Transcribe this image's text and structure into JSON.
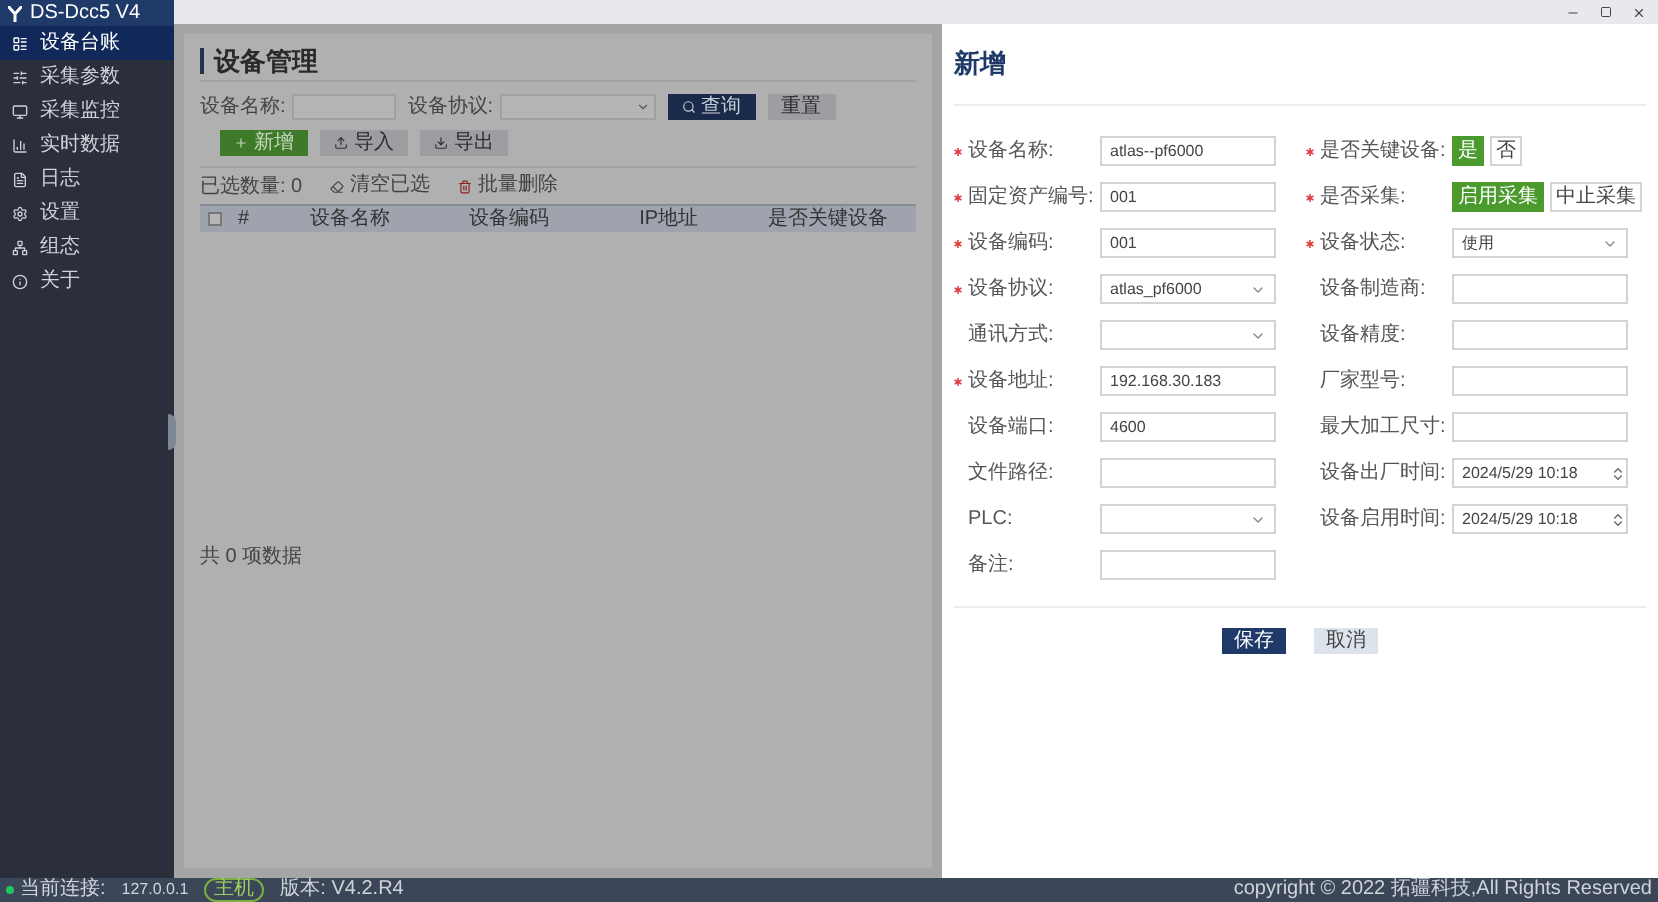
{
  "app": {
    "title": "DS-Dcc5 V4"
  },
  "sidebar": {
    "items": [
      {
        "label": "设备台账",
        "selected": true
      },
      {
        "label": "采集参数",
        "selected": false
      },
      {
        "label": "采集监控",
        "selected": false
      },
      {
        "label": "实时数据",
        "selected": false
      },
      {
        "label": "日志",
        "selected": false
      },
      {
        "label": "设置",
        "selected": false
      },
      {
        "label": "组态",
        "selected": false
      },
      {
        "label": "关于",
        "selected": false
      }
    ]
  },
  "page": {
    "title": "设备管理",
    "filters": [
      {
        "label": "设备名称:",
        "kind": "input"
      },
      {
        "label": "设备协议:",
        "kind": "select"
      }
    ],
    "buttons": [
      {
        "label": "查询",
        "kind": "primary"
      },
      {
        "label": "重置",
        "kind": "plain"
      },
      {
        "label": "新增",
        "kind": "success"
      },
      {
        "label": "导入",
        "kind": "plain"
      },
      {
        "label": "导出",
        "kind": "plain"
      }
    ],
    "selection": {
      "count": "已选数量: 0",
      "clear": "清空已选",
      "delete": "批量删除"
    },
    "table": {
      "checked": false,
      "columns": [
        "#",
        "设备名称",
        "设备编码",
        "IP地址",
        "是否关键设备"
      ],
      "footer": "共 0 项数据"
    }
  },
  "drawer": {
    "title": "新增",
    "left_fields": [
      {
        "label": "设备名称:",
        "required": true,
        "kind": "input",
        "value": "atlas--pf6000"
      },
      {
        "label": "固定资产编号:",
        "required": true,
        "kind": "input",
        "value": "001"
      },
      {
        "label": "设备编码:",
        "required": true,
        "kind": "input",
        "value": "001"
      },
      {
        "label": "设备协议:",
        "required": true,
        "kind": "select",
        "value": "atlas_pf6000"
      },
      {
        "label": "通讯方式:",
        "required": false,
        "kind": "select"
      },
      {
        "label": "设备地址:",
        "required": true,
        "kind": "input",
        "value": "192.168.30.183"
      },
      {
        "label": "设备端口:",
        "required": false,
        "kind": "input",
        "value": "4600"
      },
      {
        "label": "文件路径:",
        "required": false,
        "kind": "input"
      },
      {
        "label": "PLC:",
        "required": false,
        "kind": "select"
      },
      {
        "label": "备注:",
        "required": false,
        "kind": "input"
      }
    ],
    "right_fields": [
      {
        "label": "是否关键设备:",
        "required": true,
        "kind": "toggle",
        "options": [
          {
            "label": "是",
            "selected": true
          },
          {
            "label": "否",
            "selected": false
          }
        ]
      },
      {
        "label": "是否采集:",
        "required": true,
        "kind": "toggle",
        "options": [
          {
            "label": "启用采集",
            "selected": true
          },
          {
            "label": "中止采集",
            "selected": false
          }
        ]
      },
      {
        "label": "设备状态:",
        "required": true,
        "kind": "select",
        "value": "使用"
      },
      {
        "label": "设备制造商:",
        "required": false,
        "kind": "input"
      },
      {
        "label": "设备精度:",
        "required": false,
        "kind": "input"
      },
      {
        "label": "厂家型号:",
        "required": false,
        "kind": "input"
      },
      {
        "label": "最大加工尺寸:",
        "required": false,
        "kind": "input"
      },
      {
        "label": "设备出厂时间:",
        "required": false,
        "kind": "datetime",
        "value": "2024/5/29 10:18"
      },
      {
        "label": "设备启用时间:",
        "required": false,
        "kind": "datetime",
        "value": "2024/5/29 10:18"
      }
    ],
    "buttons": [
      {
        "label": "保存",
        "kind": "primary"
      },
      {
        "label": "取消",
        "kind": "plain"
      }
    ]
  },
  "status_bar": {
    "connection_label": "当前连接:",
    "color": "#22c55e",
    "address": "127.0.0.1",
    "role": "主机",
    "version": "版本: V4.2.R4",
    "copyright": "copyright © 2022 拓疆科技,All Rights Reserved"
  }
}
